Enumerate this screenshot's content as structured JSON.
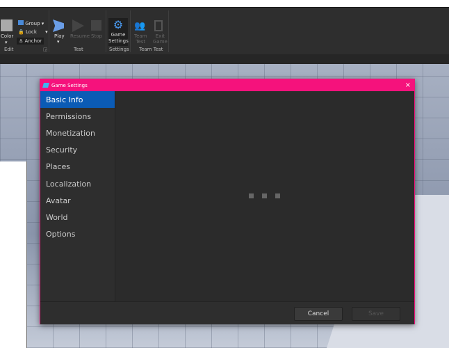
{
  "ribbon": {
    "color": "Color",
    "group": "Group",
    "lock": "Lock",
    "anchor": "Anchor",
    "edit": "Edit",
    "play": "Play",
    "resume": "Resume",
    "stop": "Stop",
    "test": "Test",
    "game_settings_1": "Game",
    "game_settings_2": "Settings",
    "settings": "Settings",
    "team_test_1": "Team",
    "team_test_2": "Test",
    "exit_1": "Exit",
    "exit_2": "Game",
    "team_test_group": "Team Test"
  },
  "dialog": {
    "title": "Game Settings",
    "close": "×",
    "menu": [
      "Basic Info",
      "Permissions",
      "Monetization",
      "Security",
      "Places",
      "Localization",
      "Avatar",
      "World",
      "Options"
    ],
    "cancel": "Cancel",
    "save": "Save"
  },
  "colors": {
    "accent": "#f5127c",
    "selected": "#0b5bb5"
  }
}
